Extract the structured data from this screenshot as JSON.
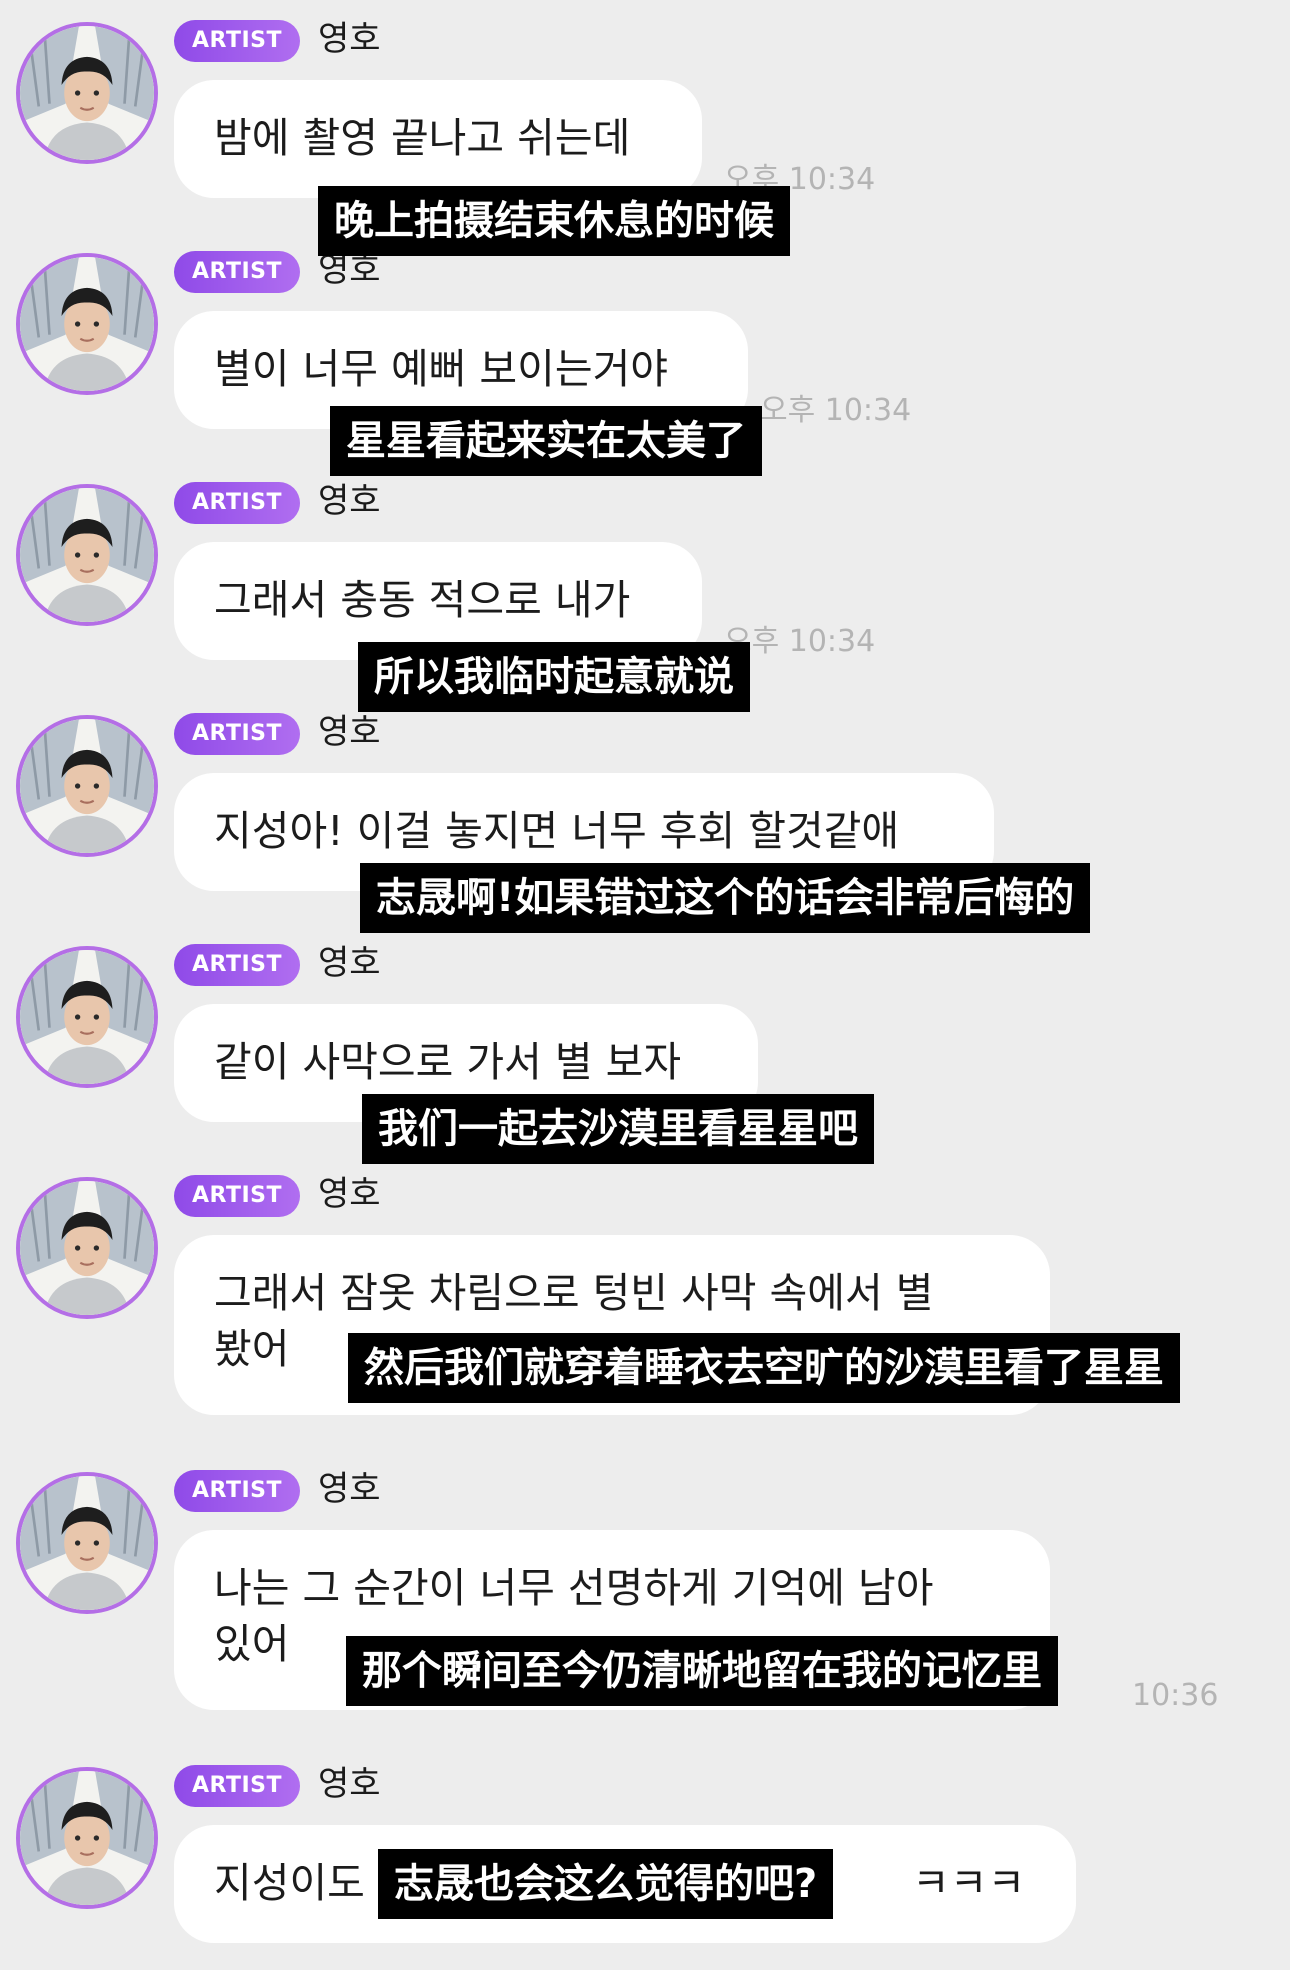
{
  "sender": {
    "badge": "ARTIST",
    "name": "영호"
  },
  "messages": [
    {
      "text": "밤에 촬영 끝나고 쉬는데",
      "time": "오후 10:34",
      "subtitle": "晚上拍摄结束休息的时候"
    },
    {
      "text": "별이 너무 예뻐 보이는거야",
      "time": "오후 10:34",
      "subtitle": "星星看起来实在太美了"
    },
    {
      "text": "그래서 충동 적으로 내가",
      "time": "오후 10:34",
      "subtitle": "所以我临时起意就说"
    },
    {
      "text": "지성아! 이걸 놓지면 너무 후회 할것같애",
      "time": "",
      "subtitle": "志晟啊!如果错过这个的话会非常后悔的"
    },
    {
      "text": "같이 사막으로 가서 별 보자",
      "time": "",
      "subtitle": "我们一起去沙漠里看星星吧"
    },
    {
      "text": "그래서 잠옷 차림으로 텅빈 사막 속에서 별\n봤어",
      "time": "",
      "subtitle": "然后我们就穿着睡衣去空旷的沙漠里看了星星"
    },
    {
      "text": "나는 그 순간이 너무 선명하게 기억에 남아\n있어",
      "time": "10:36",
      "subtitle": "那个瞬间至今仍清晰地留在我的记忆里"
    },
    {
      "text": "지성이도",
      "laugh": "ㅋㅋㅋ",
      "time": "",
      "subtitle": "志晟也会这么觉得的吧?"
    }
  ],
  "colors": {
    "background": "#ededed",
    "bubble": "#ffffff",
    "badge": "#9a55ea",
    "avatar_ring": "#b46ee6",
    "subtitle_bg": "#000000",
    "timestamp": "#b4b4b4"
  },
  "icons": {
    "avatar": "profile-photo-avatar"
  }
}
